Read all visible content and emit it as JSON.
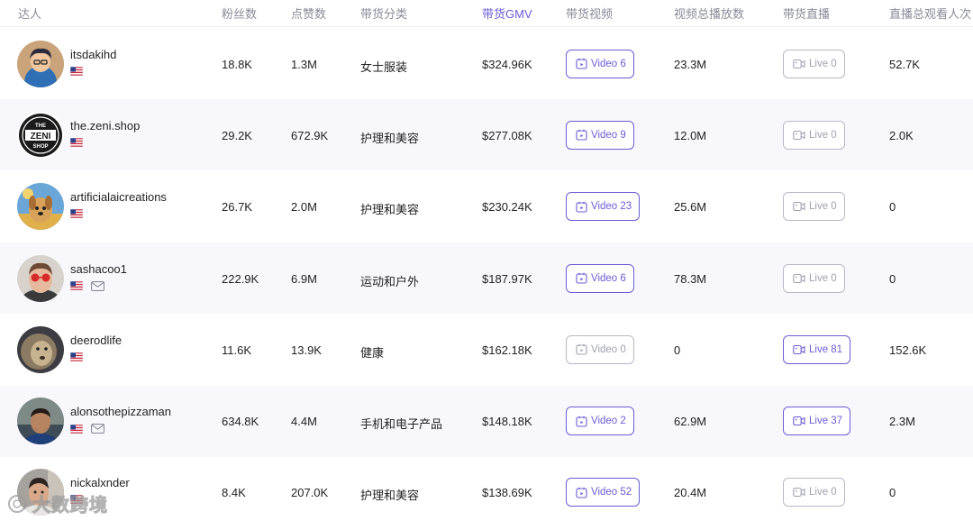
{
  "headers": {
    "creator": "达人",
    "followers": "粉丝数",
    "likes": "点赞数",
    "category": "带货分类",
    "gmv": "带货GMV",
    "videos": "带货视频",
    "video_views": "视频总播放数",
    "lives": "带货直播",
    "live_viewers": "直播总观看人次"
  },
  "colors": {
    "accent": "#6b5cd6",
    "muted": "#b8b8c8",
    "row_alt": "#f8f8fc"
  },
  "rows": [
    {
      "name": "itsdakihd",
      "has_mail": false,
      "followers": "18.8K",
      "likes": "1.3M",
      "category": "女士服装",
      "gmv": "$324.96K",
      "video_label": "Video 6",
      "video_active": true,
      "views": "23.3M",
      "live_label": "Live 0",
      "live_active": false,
      "live_viewers": "52.7K"
    },
    {
      "name": "the.zeni.shop",
      "has_mail": false,
      "followers": "29.2K",
      "likes": "672.9K",
      "category": "护理和美容",
      "gmv": "$277.08K",
      "video_label": "Video 9",
      "video_active": true,
      "views": "12.0M",
      "live_label": "Live 0",
      "live_active": false,
      "live_viewers": "2.0K"
    },
    {
      "name": "artificialaicreations",
      "has_mail": false,
      "followers": "26.7K",
      "likes": "2.0M",
      "category": "护理和美容",
      "gmv": "$230.24K",
      "video_label": "Video 23",
      "video_active": true,
      "views": "25.6M",
      "live_label": "Live 0",
      "live_active": false,
      "live_viewers": "0"
    },
    {
      "name": "sashacoo1",
      "has_mail": true,
      "followers": "222.9K",
      "likes": "6.9M",
      "category": "运动和户外",
      "gmv": "$187.97K",
      "video_label": "Video 6",
      "video_active": true,
      "views": "78.3M",
      "live_label": "Live 0",
      "live_active": false,
      "live_viewers": "0"
    },
    {
      "name": "deerodlife",
      "has_mail": false,
      "followers": "11.6K",
      "likes": "13.9K",
      "category": "健康",
      "gmv": "$162.18K",
      "video_label": "Video 0",
      "video_active": false,
      "views": "0",
      "live_label": "Live 81",
      "live_active": true,
      "live_viewers": "152.6K"
    },
    {
      "name": "alonsothepizzaman",
      "has_mail": true,
      "followers": "634.8K",
      "likes": "4.4M",
      "category": "手机和电子产品",
      "gmv": "$148.18K",
      "video_label": "Video 2",
      "video_active": true,
      "views": "62.9M",
      "live_label": "Live 37",
      "live_active": true,
      "live_viewers": "2.3M"
    },
    {
      "name": "nickalxnder",
      "has_mail": false,
      "followers": "8.4K",
      "likes": "207.0K",
      "category": "护理和美容",
      "gmv": "$138.69K",
      "video_label": "Video 52",
      "video_active": true,
      "views": "20.4M",
      "live_label": "Live 0",
      "live_active": false,
      "live_viewers": "0"
    }
  ],
  "zeni_logo": {
    "top": "THE",
    "mid": "ZENI",
    "bottom": "SHOP"
  },
  "watermark": "大数跨境"
}
